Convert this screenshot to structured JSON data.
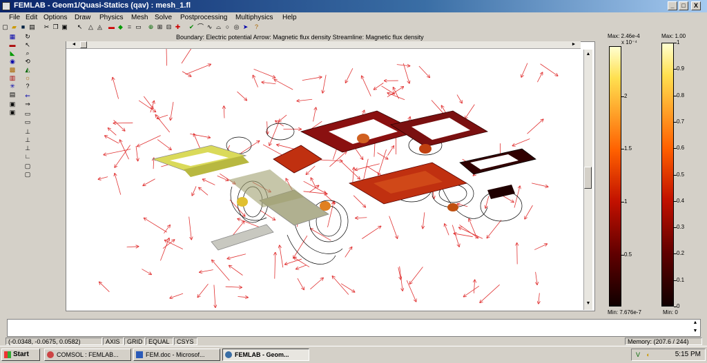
{
  "window": {
    "title": "FEMLAB - Geom1/Quasi-Statics (qav) : mesh_1.fl",
    "min": "_",
    "max": "□",
    "close": "X"
  },
  "menu": [
    "File",
    "Edit",
    "Options",
    "Draw",
    "Physics",
    "Mesh",
    "Solve",
    "Postprocessing",
    "Multiphysics",
    "Help"
  ],
  "plot": {
    "info": "Boundary: Electric potential   Arrow: Magnetic flux density   Streamline: Magnetic flux density",
    "colorbar1": {
      "max": "Max: 2.46e-4",
      "exp": "x 10⁻⁴",
      "min": "Min: 7.676e-7",
      "ticks": [
        "2",
        "1.5",
        "1",
        "0.5"
      ]
    },
    "colorbar2": {
      "max": "Max: 1.00",
      "min": "Min: 0",
      "ticks": [
        "1",
        "0.9",
        "0.8",
        "0.7",
        "0.6",
        "0.5",
        "0.4",
        "0.3",
        "0.2",
        "0.1",
        "0"
      ]
    }
  },
  "status": {
    "coords": "(-0.0348, -0.0675, 0.0582)",
    "axis": "AXIS",
    "grid": "GRID",
    "equal": "EQUAL",
    "csys": "CSYS",
    "memory": "Memory: (207.6 / 244)"
  },
  "taskbar": {
    "start": "Start",
    "tasks": [
      "COMSOL : FEMLAB...",
      "FEM.doc - Microsof...",
      "FEMLAB - Geom..."
    ],
    "clock": "5:15 PM"
  },
  "colors": {
    "cb_dark": "#1a0000",
    "cb_red": "#d02000",
    "cb_yellow": "#ffff80"
  }
}
